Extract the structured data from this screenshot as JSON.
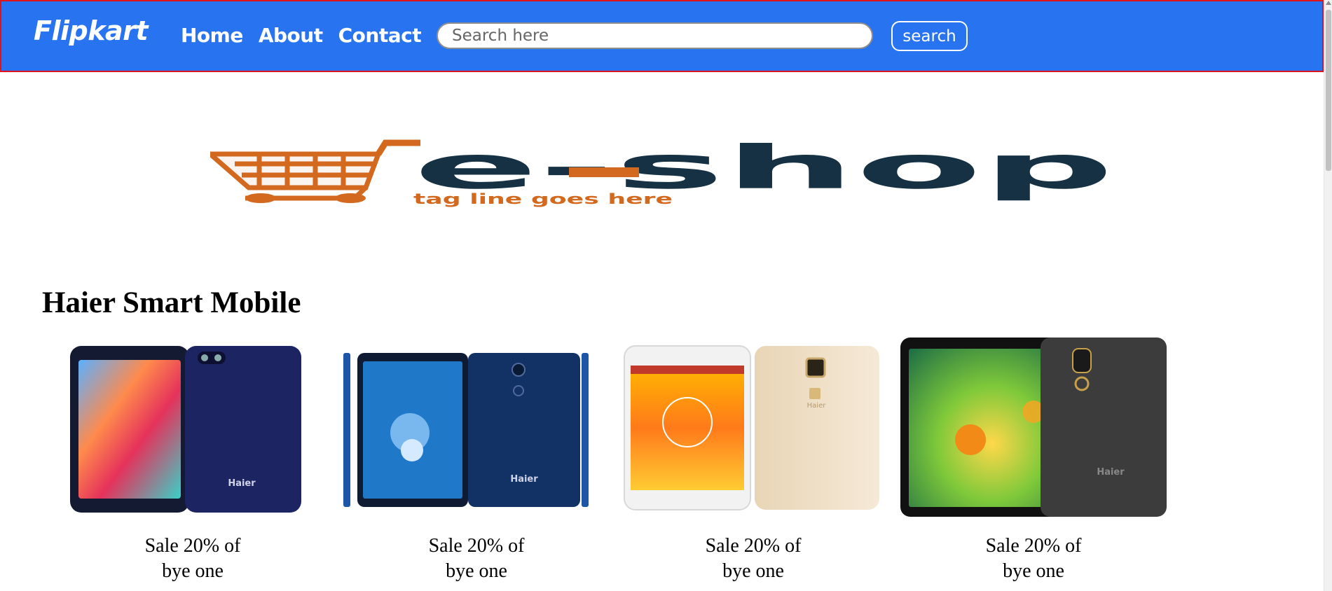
{
  "navbar": {
    "brand": "Flipkart",
    "links": [
      "Home",
      "About",
      "Contact"
    ],
    "search_placeholder": "Search here",
    "search_button": "search"
  },
  "logo": {
    "word": "e-shop",
    "tagline": "tag line goes here",
    "colors": {
      "cart": "#d2691e",
      "word": "#163143"
    }
  },
  "section": {
    "title": "Haier Smart Mobile"
  },
  "products": [
    {
      "caption_line1": "Sale 20% of",
      "caption_line2": "bye one",
      "brand_on_phone": "Haier"
    },
    {
      "caption_line1": "Sale 20% of",
      "caption_line2": "bye one",
      "brand_on_phone": "Haier"
    },
    {
      "caption_line1": "Sale 20% of",
      "caption_line2": "bye one",
      "brand_on_phone": "Haier"
    },
    {
      "caption_line1": "Sale 20% of",
      "caption_line2": "bye one",
      "brand_on_phone": "Haier"
    }
  ],
  "colors": {
    "navbar_bg": "#2874f0",
    "navbar_border": "#e0131a"
  }
}
